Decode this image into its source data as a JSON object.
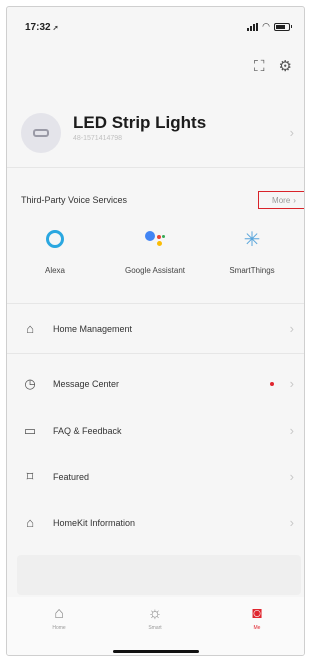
{
  "status_bar": {
    "time": "17:32",
    "location_glyph": "➚"
  },
  "device": {
    "name": "LED Strip Lights",
    "id": "48-1571414798"
  },
  "voice_services": {
    "title": "Third-Party Voice Services",
    "more_label": "More",
    "highlight_color": "#d9232a",
    "items": [
      {
        "label": "Alexa",
        "icon": "alexa-icon"
      },
      {
        "label": "Google Assistant",
        "icon": "google-assistant-icon"
      },
      {
        "label": "SmartThings",
        "icon": "smartthings-icon"
      }
    ]
  },
  "menu": [
    {
      "label": "Home Management",
      "icon": "house-icon"
    },
    {
      "label": "Message Center",
      "icon": "message-icon",
      "badge_color": "#e0262f"
    },
    {
      "label": "FAQ & Feedback",
      "icon": "faq-icon"
    },
    {
      "label": "Featured",
      "icon": "bookmark-icon"
    },
    {
      "label": "HomeKit Information",
      "icon": "homekit-icon"
    }
  ],
  "tabbar": {
    "active_color": "#e0262f",
    "tabs": [
      {
        "label": "Home",
        "icon": "home-icon"
      },
      {
        "label": "Smart",
        "icon": "smart-icon"
      },
      {
        "label": "Me",
        "icon": "me-icon",
        "active": true
      }
    ]
  }
}
